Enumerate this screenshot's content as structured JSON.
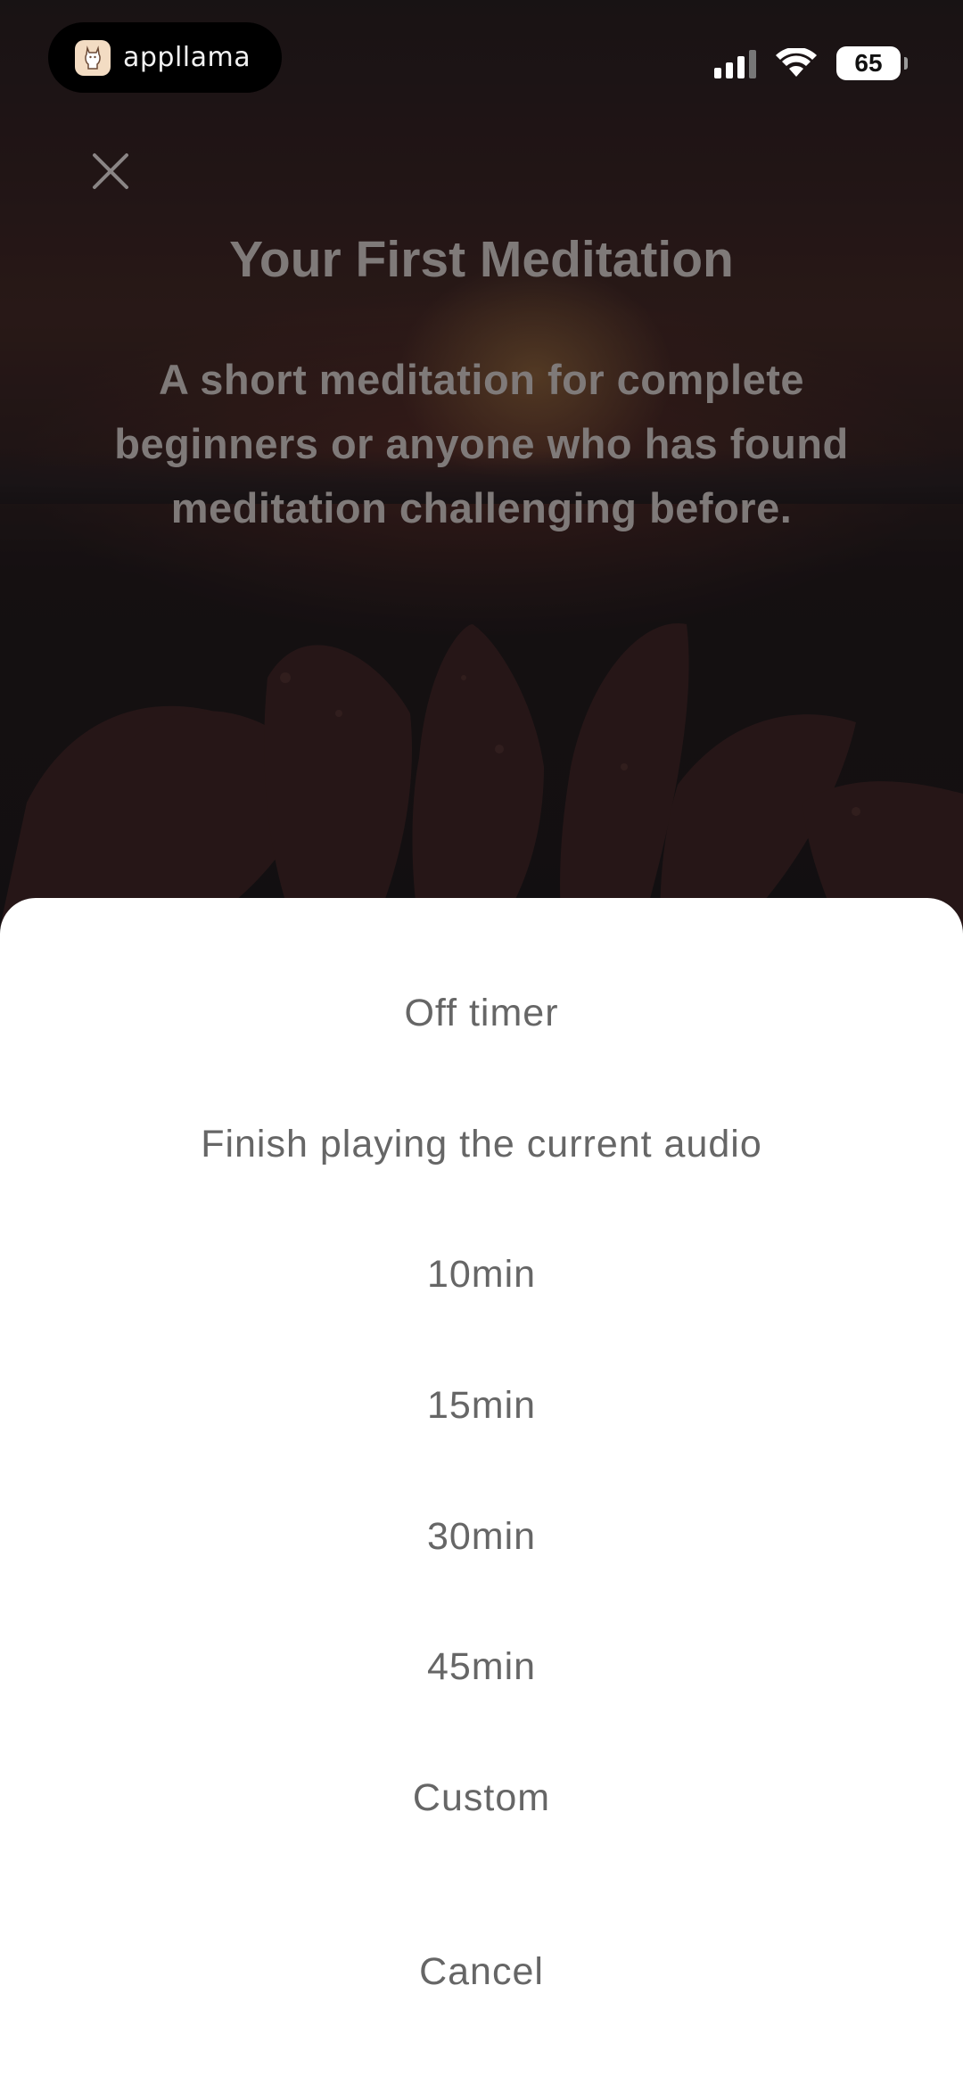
{
  "status_bar": {
    "app_name": "appllama",
    "battery": "65"
  },
  "page": {
    "title": "Your First Meditation",
    "subtitle_lines": [
      "A short meditation for complete",
      "beginners or anyone who has found",
      "meditation challenging before."
    ]
  },
  "sheet": {
    "options": [
      "Off timer",
      "Finish playing the current audio",
      "10min",
      "15min",
      "30min",
      "45min",
      "Custom"
    ],
    "cancel": "Cancel"
  }
}
